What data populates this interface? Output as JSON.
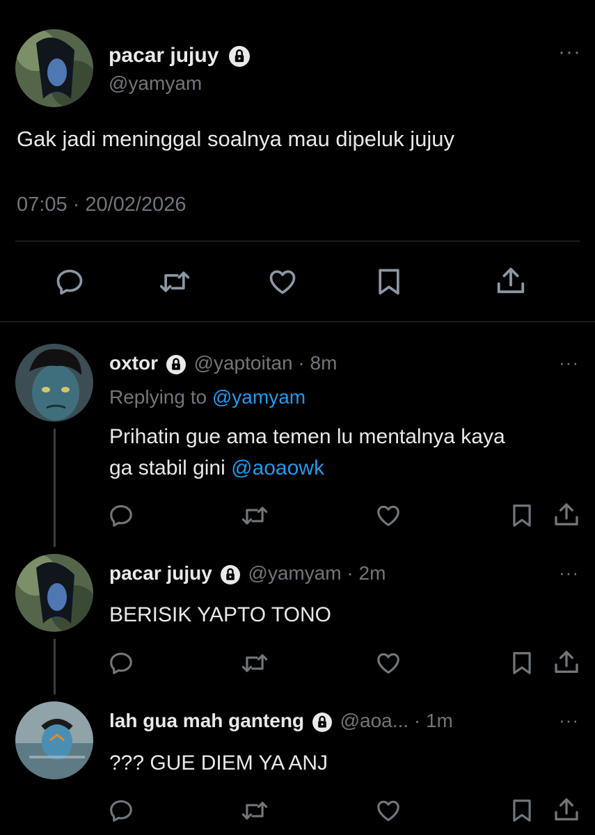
{
  "main_tweet": {
    "display_name": "pacar jujuy",
    "handle": "@yamyam",
    "text": "Gak jadi meninggal soalnya mau dipeluk jujuy",
    "timestamp": "07:05 · 20/02/2026",
    "more_label": "···"
  },
  "replies": [
    {
      "display_name": "oxtor",
      "handle": "@yaptoitan",
      "time": "· 8m",
      "replying_prefix": "Replying to",
      "replying_to": "@yamyam",
      "text_line1": "Prihatin gue ama temen lu mentalnya kaya",
      "text_line2_prefix": "ga stabil gini ",
      "text_line2_mention": "@aoaowk",
      "more_label": "···"
    },
    {
      "display_name": "pacar jujuy",
      "handle": "@yamyam",
      "time": "· 2m",
      "text": "BERISIK YAPTO TONO",
      "more_label": "···"
    },
    {
      "display_name": "lah gua mah ganteng",
      "handle": "@aoa...",
      "time": "· 1m",
      "text": "??? GUE DIEM YA ANJ",
      "more_label": "···"
    }
  ],
  "colors": {
    "background": "#000000",
    "text": "#e7e9ea",
    "muted": "#71767b",
    "link": "#1d9bf0",
    "divider": "#2f3336"
  },
  "icons": [
    "lock-icon",
    "reply-icon",
    "retweet-icon",
    "like-icon",
    "bookmark-icon",
    "share-icon",
    "more-icon"
  ]
}
